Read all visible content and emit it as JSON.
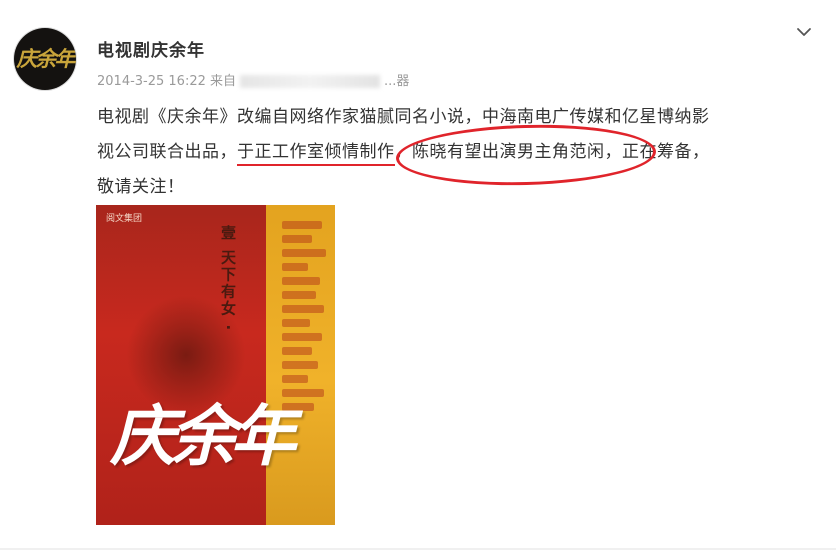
{
  "post": {
    "author_name": "电视剧庆余年",
    "avatar_text": "庆余年",
    "timestamp": "2014-3-25 16:22",
    "source_prefix": "来自",
    "source_suffix": "...器",
    "content": {
      "line1": "电视剧《庆余年》改编自网络作家猫腻同名小说，中海南电广传媒和亿星博纳影",
      "line2_part1": "视公司联合出品，",
      "line2_underlined": "于正工作室倾情制作",
      "line2_sep": "，",
      "line2_circled": "陈晓有望出演男主角范闲",
      "line2_part2": "，正在筹备，",
      "line3": "敬请关注！"
    },
    "image": {
      "top_label": "阅文集团",
      "vertical_text": "壹 天下有女 ·",
      "cover_title": "庆余年"
    }
  },
  "menu": {
    "chevron": "chevron-down-icon"
  },
  "colors": {
    "highlight_red": "#e0242b",
    "cover_red": "#b82218",
    "cover_gold": "#f0b22a"
  }
}
